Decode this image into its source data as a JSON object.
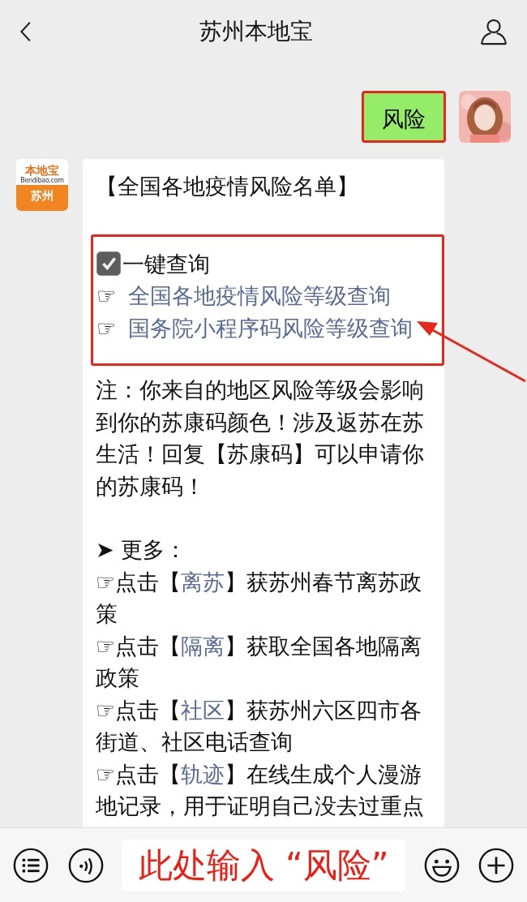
{
  "header": {
    "title": "苏州本地宝"
  },
  "user_message": {
    "text": "风险",
    "highlighted": true
  },
  "bot": {
    "logo_top": "本地宝",
    "logo_url": "Bendibao.com",
    "logo_city": "苏州",
    "title": "【全国各地疫情风险名单】",
    "query_section": {
      "highlighted": true,
      "checkbox": {
        "label": "一键查询",
        "checked": true
      },
      "links": [
        {
          "pointer": "☞",
          "text": "全国各地疫情风险等级查询"
        },
        {
          "pointer": "☞",
          "text": "国务院小程序码风险等级查询"
        }
      ]
    },
    "note": "注：你来自的地区风险等级会影响到你的苏康码颜色！涉及返苏在苏生活！回复【苏康码】可以申请你的苏康码！",
    "more_heading": "➤ 更多：",
    "items": [
      {
        "pointer": "☞",
        "before": "点击【",
        "link": "离苏",
        "after": "】获苏州春节离苏政策"
      },
      {
        "pointer": "☞",
        "before": "点击【",
        "link": "隔离",
        "after": "】获取全国各地隔离政策"
      },
      {
        "pointer": "☞",
        "before": "点击【",
        "link": "社区",
        "after": "】获苏州六区四市各街道、社区电话查询"
      },
      {
        "pointer": "☞",
        "before": "点击【",
        "link": "轨迹",
        "after": "】在线生成个人漫游地记录，用于证明自己没去过重点"
      }
    ]
  },
  "annotation": {
    "input_hint": "此处输入 “风险”"
  }
}
